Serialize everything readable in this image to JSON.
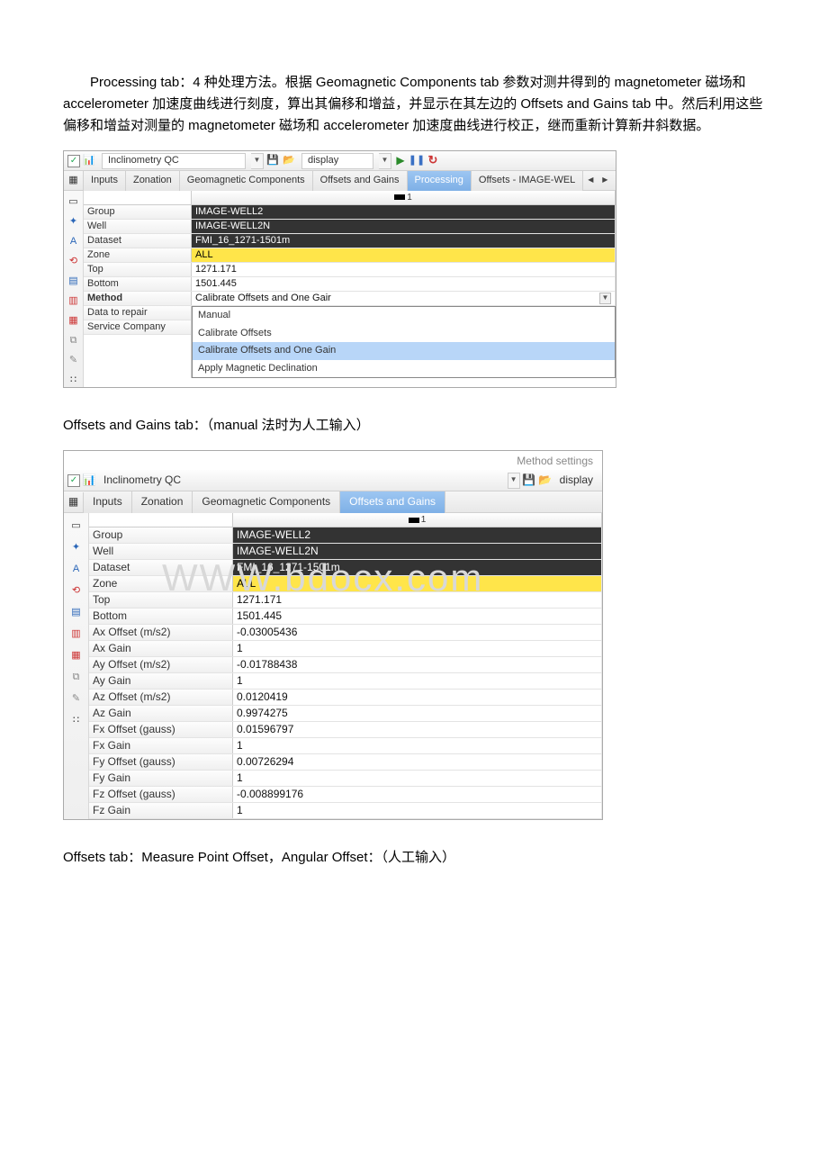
{
  "paragraph1": "Processing tab：4 种处理方法。根据 Geomagnetic Components tab 参数对测井得到的 magnetometer 磁场和 accelerometer 加速度曲线进行刻度，算出其偏移和增益，并显示在其左边的 Offsets and Gains tab 中。然后利用这些偏移和增益对测量的 magnetometer 磁场和 accelerometer 加速度曲线进行校正，继而重新计算新井斜数据。",
  "paragraph2": "Offsets and Gains tab：（manual 法时为人工输入）",
  "paragraph3": "Offsets tab：Measure Point Offset，Angular Offset：（人工输入）",
  "shot1": {
    "title": "Inclinometry QC",
    "display": "display",
    "check": "✓",
    "tabs": [
      "Inputs",
      "Zonation",
      "Geomagnetic Components",
      "Offsets and Gains",
      "Processing",
      "Offsets - IMAGE-WEL"
    ],
    "active_tab_index": 4,
    "col_num": "1",
    "rows": [
      {
        "name": "Group",
        "val": "IMAGE-WELL2",
        "style": "inv"
      },
      {
        "name": "Well",
        "val": "IMAGE-WELL2N",
        "style": "inv"
      },
      {
        "name": "Dataset",
        "val": "FMI_16_1271-1501m",
        "style": "inv"
      },
      {
        "name": "Zone",
        "val": "ALL",
        "style": "yel"
      },
      {
        "name": "Top",
        "val": "1271.171",
        "style": ""
      },
      {
        "name": "Bottom",
        "val": "1501.445",
        "style": ""
      },
      {
        "name": "Method",
        "val": "Calibrate Offsets and One Gair",
        "style": "dd",
        "bold": true
      },
      {
        "name": "Data to repair",
        "val": "",
        "style": ""
      },
      {
        "name": "Service Company",
        "val": "",
        "style": ""
      }
    ],
    "dropdown": {
      "items": [
        "Manual",
        "Calibrate Offsets",
        "Calibrate Offsets and One Gain",
        "Apply Magnetic Declination"
      ],
      "selected_index": 2
    }
  },
  "shot2": {
    "method_label": "Method settings",
    "title": "Inclinometry QC",
    "display": "display",
    "check": "✓",
    "tabs": [
      "Inputs",
      "Zonation",
      "Geomagnetic Components",
      "Offsets and Gains"
    ],
    "active_tab_index": 3,
    "col_num": "1",
    "watermark": "WWW.bdocx.com",
    "rows": [
      {
        "name": "Group",
        "val": "IMAGE-WELL2",
        "style": "inv"
      },
      {
        "name": "Well",
        "val": "IMAGE-WELL2N",
        "style": "inv"
      },
      {
        "name": "Dataset",
        "val": "FMI_16_1271-1501m",
        "style": "inv"
      },
      {
        "name": "Zone",
        "val": "ALL",
        "style": "yel"
      },
      {
        "name": "Top",
        "val": "1271.171",
        "style": ""
      },
      {
        "name": "Bottom",
        "val": "1501.445",
        "style": ""
      },
      {
        "name": "Ax Offset (m/s2)",
        "val": "-0.03005436",
        "style": ""
      },
      {
        "name": "Ax Gain",
        "val": "1",
        "style": ""
      },
      {
        "name": "Ay Offset (m/s2)",
        "val": "-0.01788438",
        "style": ""
      },
      {
        "name": "Ay Gain",
        "val": "1",
        "style": ""
      },
      {
        "name": "Az Offset (m/s2)",
        "val": "0.0120419",
        "style": ""
      },
      {
        "name": "Az Gain",
        "val": "0.9974275",
        "style": ""
      },
      {
        "name": "Fx Offset (gauss)",
        "val": "0.01596797",
        "style": ""
      },
      {
        "name": "Fx Gain",
        "val": "1",
        "style": ""
      },
      {
        "name": "Fy Offset (gauss)",
        "val": "0.00726294",
        "style": ""
      },
      {
        "name": "Fy Gain",
        "val": "1",
        "style": ""
      },
      {
        "name": "Fz Offset (gauss)",
        "val": "-0.008899176",
        "style": ""
      },
      {
        "name": "Fz Gain",
        "val": "1",
        "style": ""
      }
    ]
  }
}
